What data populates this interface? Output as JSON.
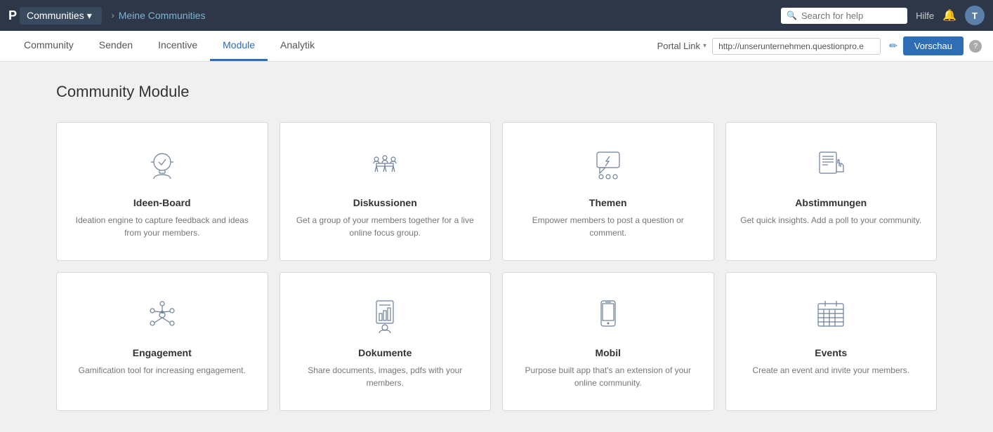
{
  "topbar": {
    "logo": "P",
    "communities_label": "Communities",
    "breadcrumb": "Meine Communities",
    "search_placeholder": "Search for help",
    "help_label": "Hilfe",
    "avatar_label": "T"
  },
  "secondary_nav": {
    "tabs": [
      {
        "id": "community",
        "label": "Community",
        "active": false
      },
      {
        "id": "senden",
        "label": "Senden",
        "active": false
      },
      {
        "id": "incentive",
        "label": "Incentive",
        "active": false
      },
      {
        "id": "module",
        "label": "Module",
        "active": true
      },
      {
        "id": "analytik",
        "label": "Analytik",
        "active": false
      }
    ],
    "portal_link_label": "Portal Link",
    "portal_url": "http://unserunternehmen.questionpro.e",
    "vorschau_label": "Vorschau"
  },
  "main": {
    "page_title": "Community Module",
    "modules": [
      {
        "id": "ideen-board",
        "name": "Ideen-Board",
        "desc": "Ideation engine to capture feedback and ideas from your members."
      },
      {
        "id": "diskussionen",
        "name": "Diskussionen",
        "desc": "Get a group of your members together for a live online focus group."
      },
      {
        "id": "themen",
        "name": "Themen",
        "desc": "Empower members to post a question or comment."
      },
      {
        "id": "abstimmungen",
        "name": "Abstimmungen",
        "desc": "Get quick insights. Add a poll to your community."
      },
      {
        "id": "engagement",
        "name": "Engagement",
        "desc": "Gamification tool for increasing engagement."
      },
      {
        "id": "dokumente",
        "name": "Dokumente",
        "desc": "Share documents, images, pdfs with your members."
      },
      {
        "id": "mobil",
        "name": "Mobil",
        "desc": "Purpose built app that's an extension of your online community."
      },
      {
        "id": "events",
        "name": "Events",
        "desc": "Create an event and invite your members."
      }
    ]
  }
}
